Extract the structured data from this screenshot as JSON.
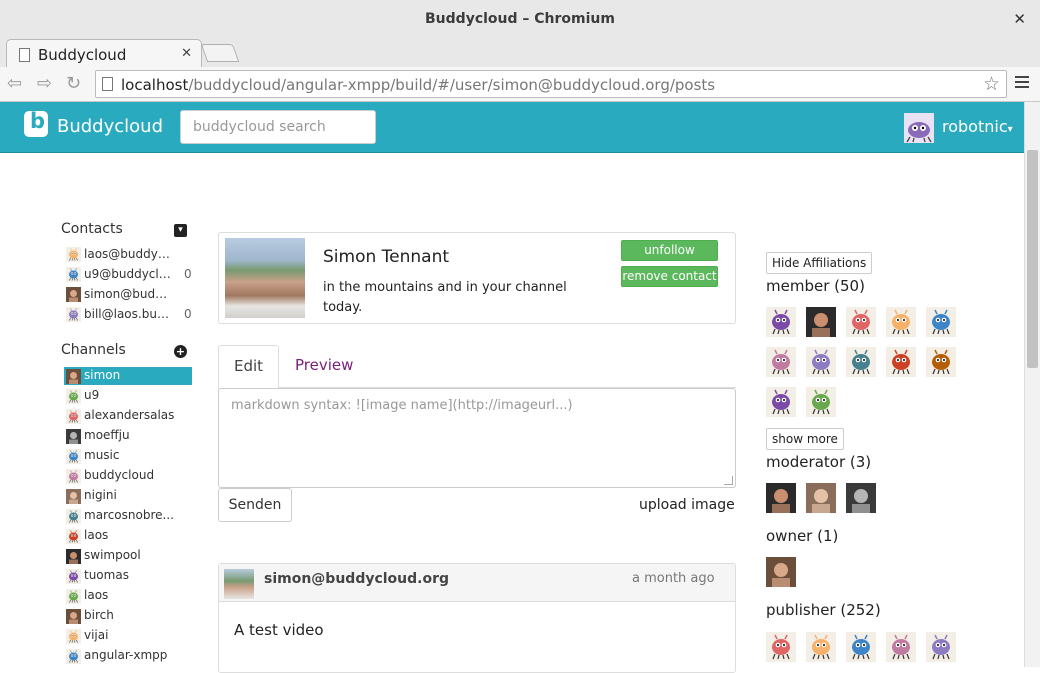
{
  "window": {
    "title": "Buddycloud – Chromium"
  },
  "tab": {
    "label": "Buddycloud"
  },
  "address": {
    "host": "localhost",
    "path": "/buddycloud/angular-xmpp/build/#/user/simon@buddycloud.org/posts"
  },
  "app": {
    "brand": "Buddycloud",
    "search_placeholder": "buddycloud search",
    "user": "robotnic"
  },
  "colors": {
    "accent": "#2aaabf",
    "success": "#5cb85c",
    "link": "#7a1f7a"
  },
  "contacts": {
    "title": "Contacts",
    "items": [
      {
        "name": "laos@buddyc...",
        "count": ""
      },
      {
        "name": "u9@buddyclo...",
        "count": "0"
      },
      {
        "name": "simon@budd...",
        "count": ""
      },
      {
        "name": "bill@laos.bud...",
        "count": "0"
      }
    ]
  },
  "channels": {
    "title": "Channels",
    "items": [
      {
        "name": "simon"
      },
      {
        "name": "u9"
      },
      {
        "name": "alexandersalas"
      },
      {
        "name": "moeffju"
      },
      {
        "name": "music"
      },
      {
        "name": "buddycloud"
      },
      {
        "name": "nigini"
      },
      {
        "name": "marcosnobre..."
      },
      {
        "name": "laos"
      },
      {
        "name": "swimpool"
      },
      {
        "name": "tuomas"
      },
      {
        "name": "laos"
      },
      {
        "name": "birch"
      },
      {
        "name": "vijai"
      },
      {
        "name": "angular-xmpp"
      }
    ]
  },
  "profile": {
    "name": "Simon Tennant",
    "bio": "in the mountains and in your channel today.",
    "unfollow_label": "unfollow",
    "remove_label": "remove contact"
  },
  "editor": {
    "tabs": [
      "Edit",
      "Preview"
    ],
    "placeholder": "markdown syntax: ![image name](http://imageurl...)",
    "send_label": "Senden",
    "upload_label": "upload image"
  },
  "post": {
    "author": "simon@buddycloud.org",
    "time": "a month ago",
    "body": "A test video"
  },
  "affiliations": {
    "hide_label": "Hide Affiliations",
    "show_more_label": "show more",
    "member": "member (50)",
    "moderator": "moderator (3)",
    "owner": "owner (1)",
    "publisher": "publisher (252)"
  }
}
